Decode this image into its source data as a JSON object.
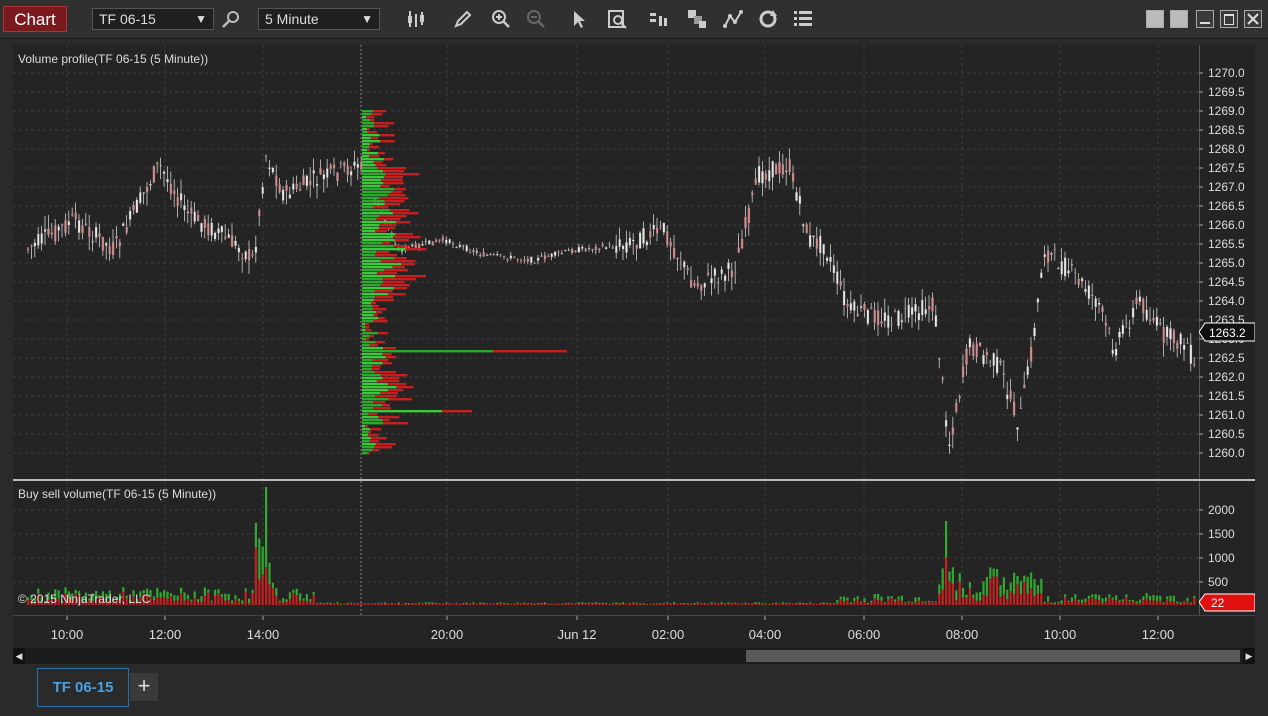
{
  "toolbar": {
    "chart_label": "Chart",
    "instrument": "TF 06-15",
    "interval": "5 Minute",
    "icons": [
      "search-icon",
      "bar-type-icon",
      "draw-pencil-icon",
      "zoom-in-icon",
      "zoom-out-icon",
      "pointer-icon",
      "data-box-icon",
      "indicators-icon",
      "strategies-icon",
      "drawing-tools-icon",
      "refresh-icon",
      "properties-icon"
    ]
  },
  "price_panel": {
    "title": "Volume profile(TF 06-15 (5 Minute))",
    "price_ticks": [
      "1270.0",
      "1269.5",
      "1269.0",
      "1268.5",
      "1268.0",
      "1267.5",
      "1267.0",
      "1266.5",
      "1266.0",
      "1265.5",
      "1265.0",
      "1264.5",
      "1264.0",
      "1263.5",
      "1263.0",
      "1262.5",
      "1262.0",
      "1261.5",
      "1261.0",
      "1260.5",
      "1260.0"
    ],
    "last_price": "1263.2"
  },
  "volume_panel": {
    "title": "Buy sell volume(TF 06-15 (5 Minute))",
    "volume_ticks": [
      "2000",
      "1500",
      "1000",
      "500"
    ],
    "last_volume": "22"
  },
  "copyright": "© 2015 NinjaTrader, LLC",
  "time_axis": {
    "labels": [
      "10:00",
      "12:00",
      "14:00",
      "20:00",
      "Jun 12",
      "02:00",
      "04:00",
      "06:00",
      "08:00",
      "10:00",
      "12:00"
    ]
  },
  "tabs": {
    "active": "TF 06-15",
    "add": "+"
  },
  "colors": {
    "up": "#2fa82f",
    "down": "#c42020",
    "candle_up": "#e8e8e8",
    "candle_down": "#d98a8a",
    "accent": "#7a1a1f"
  }
}
